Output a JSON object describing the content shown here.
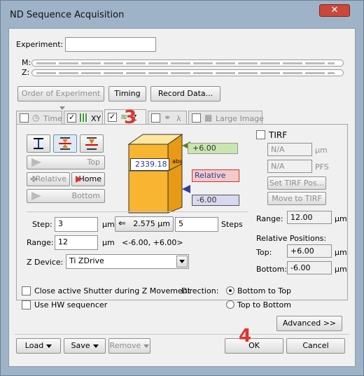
{
  "window": {
    "title": "ND Sequence Acquisition",
    "close": "✕"
  },
  "experiment": {
    "label": "Experiment:",
    "value": ""
  },
  "rows": {
    "m_label": "M:",
    "z_label": "Z:"
  },
  "toolbar": {
    "order": "Order of Experiment",
    "timing": "Timing",
    "record": "Record Data..."
  },
  "tabs": {
    "time": "Time",
    "xy": "XY",
    "z": "Z",
    "lambda": "λ",
    "large_image": "Large Image"
  },
  "annotations": {
    "step3": "3",
    "step4": "4"
  },
  "zcontrols": {
    "top": "Top",
    "relative": "Relative",
    "home": "Home",
    "bottom": "Bottom"
  },
  "cube": {
    "top_val": "+6.00",
    "center_val": "2339.18",
    "abs": "abs",
    "relative": "Relative",
    "bottom_val": "-6.00"
  },
  "tirf": {
    "label": "TIRF",
    "na1": "N/A",
    "unit1": "μm",
    "na2": "N/A",
    "unit2": "PFS",
    "set_pos": "Set TIRF Pos...",
    "move": "Move to TIRF"
  },
  "step": {
    "label": "Step:",
    "value": "3",
    "unit": "μm",
    "calc": "2.575 μm",
    "steps_value": "5",
    "steps_label": "Steps"
  },
  "range": {
    "label": "Range:",
    "value": "12",
    "unit": "μm",
    "bounds": "<-6.00, +6.00>"
  },
  "range_right": {
    "label": "Range:",
    "value": "12.00",
    "unit": "μm"
  },
  "relpos": {
    "title": "Relative Positions:",
    "top_label": "Top:",
    "top_value": "+6.00",
    "top_unit": "μm",
    "bottom_label": "Bottom:",
    "bottom_value": "-6.00",
    "bottom_unit": "μm"
  },
  "zdevice": {
    "label": "Z Device:",
    "value": "Ti ZDrive"
  },
  "options": {
    "close_shutter": "Close active Shutter during Z Movement",
    "hw_seq": "Use HW sequencer"
  },
  "direction": {
    "label": "Direction:",
    "b2t": "Bottom to Top",
    "t2b": "Top to Bottom"
  },
  "advanced": "Advanced >>",
  "footer": {
    "load": "Load",
    "save": "Save",
    "remove": "Remove",
    "ok": "OK",
    "cancel": "Cancel"
  },
  "colors": {
    "accent_red": "#e0332a",
    "cube_orange": "#f7b531",
    "green_label": "#c9e6b0",
    "red_label": "#f5c9c9",
    "blue_label": "#d8d8f0"
  }
}
